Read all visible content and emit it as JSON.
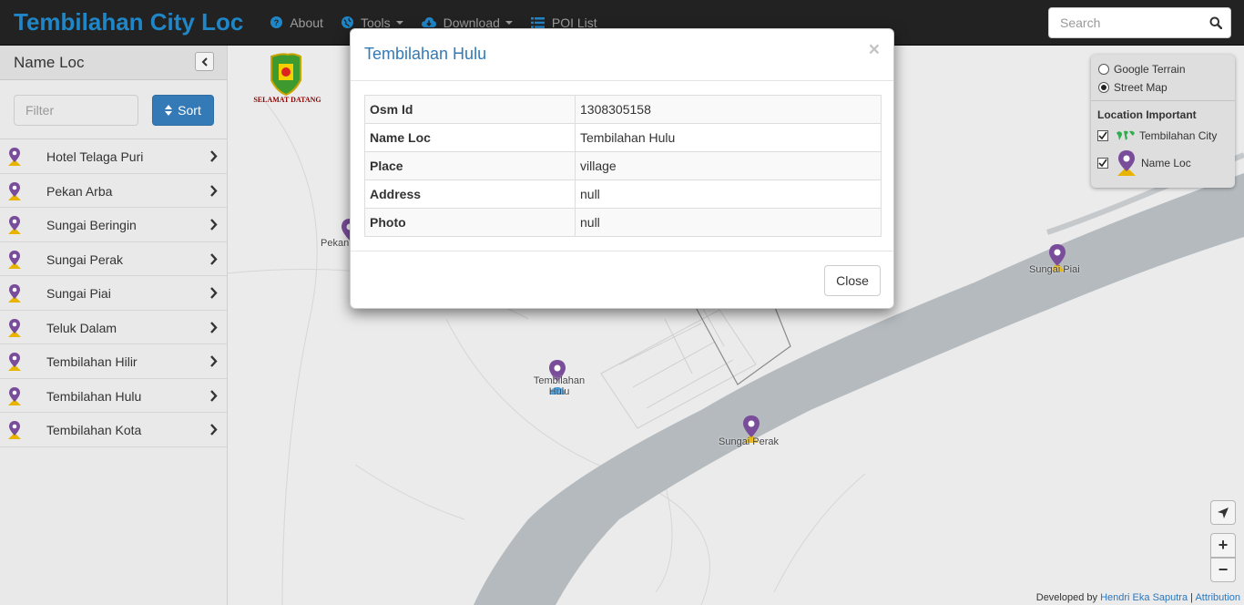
{
  "navbar": {
    "brand": "Tembilahan City Loc",
    "about": "About",
    "tools": "Tools",
    "download": "Download",
    "poi_list": "POI List",
    "search_placeholder": "Search"
  },
  "sidebar": {
    "title": "Name Loc",
    "filter_placeholder": "Filter",
    "sort_label": "Sort",
    "items": [
      {
        "label": "Hotel Telaga Puri"
      },
      {
        "label": "Pekan Arba"
      },
      {
        "label": "Sungai Beringin"
      },
      {
        "label": "Sungai Perak"
      },
      {
        "label": "Sungai Piai"
      },
      {
        "label": "Teluk Dalam"
      },
      {
        "label": "Tembilahan Hilir"
      },
      {
        "label": "Tembilahan Hulu"
      },
      {
        "label": "Tembilahan Kota"
      }
    ]
  },
  "map": {
    "logo_caption": "SELAMAT DATANG",
    "labels": {
      "pekan": "Pekan",
      "sungai_piai": "Sungai Piai",
      "tembilahan_hulu": "Tembilahan Hulu",
      "sungai_perak": "Sungai Perak"
    },
    "layers": {
      "google_terrain": "Google Terrain",
      "street_map": "Street Map",
      "selected": "street_map",
      "overlay_title": "Location Important",
      "overlay_city": "Tembilahan City",
      "overlay_nameloc": "Name Loc"
    },
    "zoom_in": "+",
    "zoom_out": "−",
    "attribution_prefix": "Developed by",
    "attribution_author": "Hendri Eka Saputra",
    "attribution_sep": "|",
    "attribution_link": "Attribution"
  },
  "modal": {
    "title": "Tembilahan Hulu",
    "close_x": "×",
    "rows": [
      {
        "key": "Osm Id",
        "value": "1308305158"
      },
      {
        "key": "Name Loc",
        "value": "Tembilahan Hulu"
      },
      {
        "key": "Place",
        "value": "village"
      },
      {
        "key": "Address",
        "value": "null"
      },
      {
        "key": "Photo",
        "value": "null"
      }
    ],
    "close_label": "Close"
  },
  "colors": {
    "brand": "#1f86c8",
    "primary": "#337ab7",
    "navbar_bg": "#222222",
    "pin": "#7a4d9b",
    "pin_base": "#e8b400",
    "river": "#aab1b6"
  }
}
